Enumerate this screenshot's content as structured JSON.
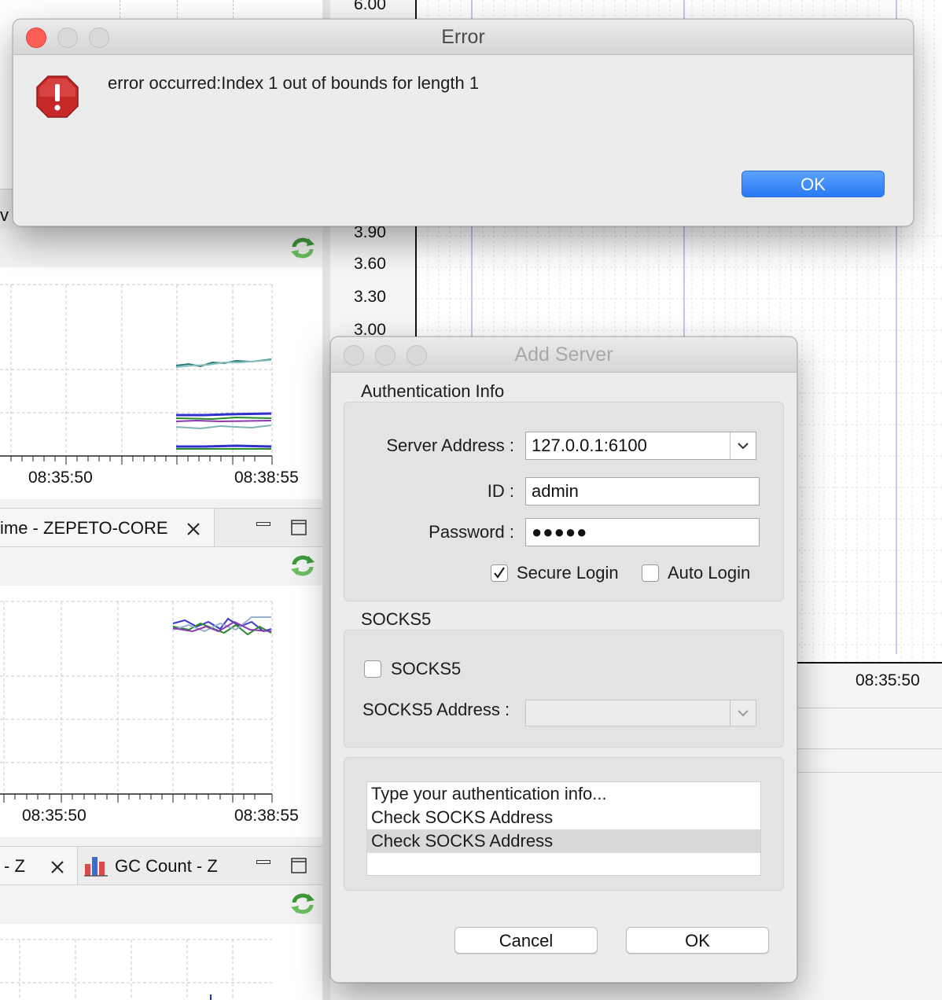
{
  "background": {
    "left_panel": {
      "chart1": {
        "time_labels": [
          "08:35:50",
          "08:38:55"
        ]
      },
      "tab_row_1": {
        "tab_title": "ime - ZEPETO-CORE"
      },
      "chart2": {
        "time_labels": [
          "08:35:50",
          "08:38:55"
        ]
      },
      "tab_row_2": {
        "tab1_title": "- Z",
        "tab2_title": "GC Count - Z"
      },
      "partial_text": "v"
    },
    "right_panel": {
      "y_axis_labels": [
        "6.00",
        "3.90",
        "3.60",
        "3.30",
        "3.00"
      ],
      "time_label": "08:35:50"
    }
  },
  "error_dialog": {
    "title": "Error",
    "message": "error occurred:Index 1 out of bounds for length 1",
    "ok_label": "OK",
    "icon": "alert-stop-icon"
  },
  "add_server_dialog": {
    "title": "Add Server",
    "auth_section_title": "Authentication Info",
    "server_address_label": "Server Address :",
    "server_address_value": "127.0.0.1:6100",
    "id_label": "ID :",
    "id_value": "admin",
    "password_label": "Password :",
    "password_value": "●●●●●",
    "secure_login_label": "Secure Login",
    "secure_login_checked": true,
    "auto_login_label": "Auto Login",
    "auto_login_checked": false,
    "socks_section_title": "SOCKS5",
    "socks5_checkbox_label": "SOCKS5",
    "socks5_checked": false,
    "socks5_address_label": "SOCKS5 Address :",
    "socks5_address_value": "",
    "messages": [
      "Type your authentication info...",
      "Check SOCKS Address",
      "Check SOCKS Address"
    ],
    "cancel_label": "Cancel",
    "ok_label": "OK"
  },
  "colors": {
    "accent_blue": "#2a79f2",
    "close_red": "#fc5f57",
    "error_icon_red": "#d32f2f"
  }
}
